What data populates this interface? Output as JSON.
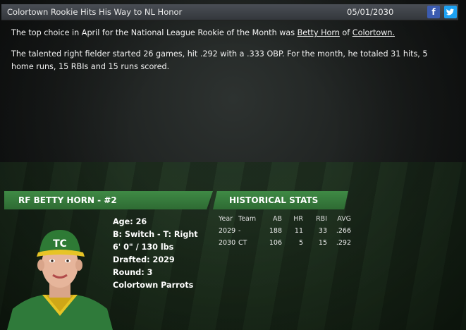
{
  "news": {
    "title": "Colortown Rookie Hits His Way to NL Honor",
    "date": "05/01/2030",
    "p1_prefix": "The top choice in April for the National League Rookie of the Month was ",
    "p1_player": "Betty Horn",
    "p1_mid": " of ",
    "p1_team": "Colortown.",
    "p2": "The talented right fielder started 26 games, hit .292 with a .333 OBP. For the month, he totaled 31 hits, 5 home runs, 15 RBIs and 15 runs scored."
  },
  "social": {
    "facebook": "f",
    "twitter": "t"
  },
  "player": {
    "header": "RF BETTY HORN - #2",
    "age": "Age: 26",
    "bats_throws": "B: Switch - T: Right",
    "size": "6' 0\" / 130 lbs",
    "drafted": "Drafted: 2029",
    "round": "Round: 3",
    "team": "Colortown Parrots",
    "cap_logo": "TC"
  },
  "historical": {
    "header": "HISTORICAL STATS",
    "columns": [
      "Year",
      "Team",
      "AB",
      "HR",
      "RBI",
      "AVG"
    ],
    "rows": [
      [
        "2029",
        "-",
        "188",
        "11",
        "33",
        ".266"
      ],
      [
        "2030",
        "CT",
        "106",
        "5",
        "15",
        ".292"
      ]
    ]
  }
}
